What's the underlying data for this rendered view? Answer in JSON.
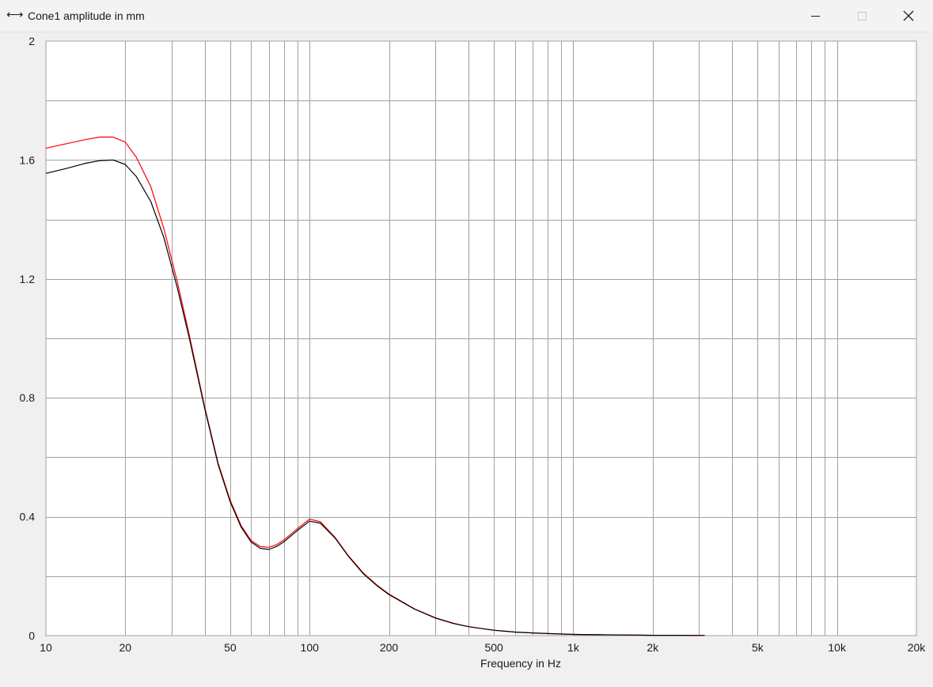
{
  "window": {
    "title": "Cone1 amplitude in mm",
    "title_icon": "double-arrow-icon",
    "controls": [
      "minimize-icon",
      "maximize-icon",
      "close-icon"
    ],
    "close_glyph": "✕",
    "icon_glyph": "⟷"
  },
  "chart_data": {
    "type": "line",
    "title": "",
    "xlabel": "Frequency in Hz",
    "ylabel": "",
    "xscale": "log",
    "xlim": [
      10,
      20000
    ],
    "ylim": [
      0,
      2
    ],
    "grid": true,
    "x_ticks": [
      {
        "value": 10,
        "label": "10"
      },
      {
        "value": 20,
        "label": "20"
      },
      {
        "value": 50,
        "label": "50"
      },
      {
        "value": 100,
        "label": "100"
      },
      {
        "value": 200,
        "label": "200"
      },
      {
        "value": 500,
        "label": "500"
      },
      {
        "value": 1000,
        "label": "1k"
      },
      {
        "value": 2000,
        "label": "2k"
      },
      {
        "value": 5000,
        "label": "5k"
      },
      {
        "value": 10000,
        "label": "10k"
      },
      {
        "value": 20000,
        "label": "20k"
      }
    ],
    "y_ticks": [
      {
        "value": 0,
        "label": "0"
      },
      {
        "value": 0.4,
        "label": "0.4"
      },
      {
        "value": 0.8,
        "label": "0.8"
      },
      {
        "value": 1.2,
        "label": "1.2"
      },
      {
        "value": 1.6,
        "label": "1.6"
      },
      {
        "value": 2,
        "label": "2"
      }
    ],
    "y_grid_minor": [
      0.2,
      0.6,
      1.0,
      1.4,
      1.8
    ],
    "series": [
      {
        "color": "#ff0000",
        "x": [
          10,
          12,
          14,
          16,
          18,
          20,
          22,
          25,
          28,
          31.5,
          35,
          40,
          45,
          50,
          55,
          60,
          65,
          70,
          75,
          80,
          90,
          100,
          110,
          125,
          140,
          160,
          180,
          200,
          250,
          300,
          350,
          400,
          500,
          600,
          700,
          800,
          1000,
          1250,
          1600,
          2000,
          2500,
          3150
        ],
        "values": [
          1.64,
          1.655,
          1.668,
          1.677,
          1.677,
          1.66,
          1.61,
          1.51,
          1.37,
          1.19,
          1.01,
          0.77,
          0.58,
          0.455,
          0.37,
          0.32,
          0.3,
          0.297,
          0.306,
          0.322,
          0.36,
          0.392,
          0.383,
          0.33,
          0.27,
          0.21,
          0.17,
          0.14,
          0.09,
          0.06,
          0.042,
          0.03,
          0.018,
          0.012,
          0.009,
          0.007,
          0.004,
          0.003,
          0.002,
          0.001,
          0.001,
          0.0005
        ]
      },
      {
        "color": "#000000",
        "x": [
          10,
          12,
          14,
          16,
          18,
          20,
          22,
          25,
          28,
          31.5,
          35,
          40,
          45,
          50,
          55,
          60,
          65,
          70,
          75,
          80,
          90,
          100,
          110,
          125,
          140,
          160,
          180,
          200,
          250,
          300,
          350,
          400,
          500,
          600,
          700,
          800,
          1000,
          1250,
          1600,
          2000,
          2500,
          3150
        ],
        "values": [
          1.555,
          1.572,
          1.588,
          1.598,
          1.6,
          1.585,
          1.545,
          1.46,
          1.34,
          1.17,
          1.0,
          0.765,
          0.575,
          0.45,
          0.365,
          0.315,
          0.294,
          0.29,
          0.3,
          0.316,
          0.354,
          0.385,
          0.378,
          0.328,
          0.268,
          0.208,
          0.168,
          0.138,
          0.089,
          0.059,
          0.041,
          0.03,
          0.018,
          0.012,
          0.009,
          0.007,
          0.004,
          0.003,
          0.002,
          0.001,
          0.001,
          0.0005
        ]
      }
    ]
  }
}
